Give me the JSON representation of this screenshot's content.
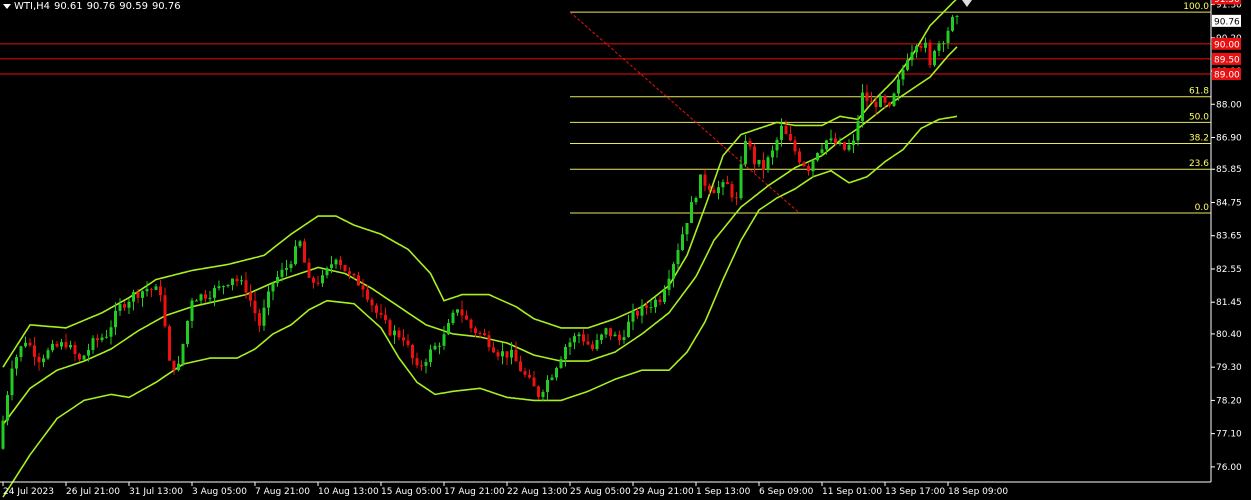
{
  "header": {
    "symbol": "WTI,H4",
    "open": "90.61",
    "high": "90.76",
    "low": "90.59",
    "close": "90.76"
  },
  "colors": {
    "background": "#000000",
    "bull": "#22cc22",
    "bear": "#ee1111",
    "bands": "#a8f020",
    "fib": "#e8e860",
    "sr_line": "#e81010",
    "grid_text": "#ffffff"
  },
  "chart_data": {
    "type": "candlestick",
    "symbol": "WTI",
    "timeframe": "H4",
    "ylim": [
      75.5,
      91.45
    ],
    "y_ticks": [
      76.0,
      77.1,
      78.2,
      79.3,
      80.4,
      81.45,
      82.55,
      83.65,
      84.75,
      85.85,
      86.9,
      88.0,
      89.1,
      90.2,
      91.3
    ],
    "x_ticks": [
      {
        "bar": 0,
        "label": "24 Jul 2023"
      },
      {
        "bar": 14,
        "label": "26 Jul 21:00"
      },
      {
        "bar": 28,
        "label": "31 Jul 13:00"
      },
      {
        "bar": 42,
        "label": "3 Aug 05:00"
      },
      {
        "bar": 56,
        "label": "7 Aug 21:00"
      },
      {
        "bar": 70,
        "label": "10 Aug 13:00"
      },
      {
        "bar": 84,
        "label": "15 Aug 05:00"
      },
      {
        "bar": 98,
        "label": "17 Aug 21:00"
      },
      {
        "bar": 112,
        "label": "22 Aug 13:00"
      },
      {
        "bar": 126,
        "label": "25 Aug 05:00"
      },
      {
        "bar": 140,
        "label": "29 Aug 21:00"
      },
      {
        "bar": 154,
        "label": "1 Sep 13:00"
      },
      {
        "bar": 168,
        "label": "6 Sep 09:00"
      },
      {
        "bar": 182,
        "label": "11 Sep 01:00"
      },
      {
        "bar": 196,
        "label": "13 Sep 17:00"
      },
      {
        "bar": 210,
        "label": "18 Sep 09:00"
      }
    ],
    "close_path": [
      [
        0,
        76.6
      ],
      [
        3,
        79.4
      ],
      [
        6,
        80.2
      ],
      [
        9,
        79.6
      ],
      [
        12,
        79.9
      ],
      [
        15,
        80.1
      ],
      [
        18,
        79.5
      ],
      [
        21,
        80.1
      ],
      [
        24,
        80.4
      ],
      [
        27,
        81.3
      ],
      [
        30,
        81.7
      ],
      [
        33,
        81.9
      ],
      [
        36,
        81.8
      ],
      [
        38,
        79.4
      ],
      [
        40,
        79.3
      ],
      [
        43,
        81.6
      ],
      [
        46,
        81.7
      ],
      [
        49,
        81.9
      ],
      [
        52,
        82.3
      ],
      [
        55,
        81.9
      ],
      [
        58,
        80.7
      ],
      [
        61,
        82.1
      ],
      [
        64,
        82.6
      ],
      [
        67,
        83.4
      ],
      [
        69,
        82.1
      ],
      [
        72,
        82.2
      ],
      [
        75,
        83.0
      ],
      [
        78,
        82.3
      ],
      [
        81,
        82.0
      ],
      [
        84,
        81.1
      ],
      [
        87,
        80.5
      ],
      [
        90,
        80.3
      ],
      [
        93,
        79.2
      ],
      [
        96,
        79.8
      ],
      [
        99,
        80.3
      ],
      [
        102,
        81.3
      ],
      [
        105,
        80.6
      ],
      [
        108,
        80.3
      ],
      [
        111,
        79.8
      ],
      [
        114,
        79.7
      ],
      [
        117,
        79.0
      ],
      [
        120,
        78.4
      ],
      [
        123,
        79.1
      ],
      [
        126,
        80.0
      ],
      [
        129,
        80.4
      ],
      [
        132,
        79.9
      ],
      [
        135,
        80.5
      ],
      [
        138,
        80.2
      ],
      [
        141,
        81.0
      ],
      [
        144,
        81.3
      ],
      [
        147,
        81.6
      ],
      [
        150,
        82.8
      ],
      [
        153,
        84.2
      ],
      [
        156,
        85.5
      ],
      [
        159,
        85.2
      ],
      [
        162,
        85.3
      ],
      [
        164,
        84.8
      ],
      [
        166,
        86.9
      ],
      [
        168,
        86.1
      ],
      [
        170,
        85.9
      ],
      [
        172,
        86.4
      ],
      [
        174,
        87.2
      ],
      [
        176,
        86.7
      ],
      [
        178,
        86.2
      ],
      [
        180,
        85.9
      ],
      [
        182,
        86.5
      ],
      [
        184,
        86.8
      ],
      [
        186,
        86.7
      ],
      [
        188,
        86.5
      ],
      [
        190,
        86.7
      ],
      [
        192,
        88.3
      ],
      [
        194,
        88.0
      ],
      [
        196,
        88.1
      ],
      [
        198,
        87.8
      ],
      [
        200,
        88.7
      ],
      [
        202,
        89.6
      ],
      [
        204,
        90.1
      ],
      [
        206,
        89.9
      ],
      [
        207,
        89.2
      ],
      [
        208,
        89.9
      ],
      [
        210,
        90.2
      ],
      [
        212,
        90.76
      ]
    ],
    "bands": {
      "upper": [
        [
          0,
          79.3
        ],
        [
          6,
          80.7
        ],
        [
          14,
          80.6
        ],
        [
          22,
          81.1
        ],
        [
          28,
          81.6
        ],
        [
          34,
          82.2
        ],
        [
          42,
          82.5
        ],
        [
          50,
          82.7
        ],
        [
          58,
          83.0
        ],
        [
          64,
          83.7
        ],
        [
          70,
          84.3
        ],
        [
          74,
          84.3
        ],
        [
          78,
          84.0
        ],
        [
          84,
          83.7
        ],
        [
          90,
          83.2
        ],
        [
          95,
          82.4
        ],
        [
          98,
          81.5
        ],
        [
          102,
          81.7
        ],
        [
          108,
          81.7
        ],
        [
          114,
          81.3
        ],
        [
          118,
          80.9
        ],
        [
          124,
          80.6
        ],
        [
          130,
          80.6
        ],
        [
          136,
          80.9
        ],
        [
          142,
          81.3
        ],
        [
          148,
          82.0
        ],
        [
          152,
          83.0
        ],
        [
          156,
          84.6
        ],
        [
          160,
          86.3
        ],
        [
          164,
          87.0
        ],
        [
          168,
          87.2
        ],
        [
          172,
          87.4
        ],
        [
          176,
          87.3
        ],
        [
          182,
          87.3
        ],
        [
          186,
          87.6
        ],
        [
          190,
          87.5
        ],
        [
          194,
          88.2
        ],
        [
          198,
          88.8
        ],
        [
          202,
          89.6
        ],
        [
          206,
          90.6
        ],
        [
          210,
          91.2
        ],
        [
          212,
          91.5
        ]
      ],
      "middle": [
        [
          0,
          77.4
        ],
        [
          6,
          78.6
        ],
        [
          12,
          79.2
        ],
        [
          18,
          79.5
        ],
        [
          24,
          79.9
        ],
        [
          30,
          80.5
        ],
        [
          36,
          81.0
        ],
        [
          42,
          81.3
        ],
        [
          48,
          81.5
        ],
        [
          54,
          81.7
        ],
        [
          60,
          82.1
        ],
        [
          66,
          82.4
        ],
        [
          70,
          82.6
        ],
        [
          76,
          82.4
        ],
        [
          82,
          81.9
        ],
        [
          88,
          81.3
        ],
        [
          94,
          80.7
        ],
        [
          100,
          80.4
        ],
        [
          106,
          80.3
        ],
        [
          112,
          80.1
        ],
        [
          118,
          79.7
        ],
        [
          124,
          79.5
        ],
        [
          130,
          79.5
        ],
        [
          136,
          79.8
        ],
        [
          142,
          80.4
        ],
        [
          148,
          81.1
        ],
        [
          154,
          82.3
        ],
        [
          158,
          83.5
        ],
        [
          164,
          84.6
        ],
        [
          170,
          85.3
        ],
        [
          176,
          85.9
        ],
        [
          182,
          86.3
        ],
        [
          186,
          86.8
        ],
        [
          190,
          87.2
        ],
        [
          196,
          87.9
        ],
        [
          202,
          88.5
        ],
        [
          206,
          88.9
        ],
        [
          210,
          89.6
        ],
        [
          212,
          89.9
        ]
      ],
      "lower": [
        [
          0,
          75.0
        ],
        [
          6,
          76.4
        ],
        [
          12,
          77.6
        ],
        [
          18,
          78.2
        ],
        [
          24,
          78.4
        ],
        [
          28,
          78.3
        ],
        [
          34,
          78.8
        ],
        [
          40,
          79.4
        ],
        [
          46,
          79.6
        ],
        [
          52,
          79.6
        ],
        [
          56,
          79.9
        ],
        [
          60,
          80.4
        ],
        [
          64,
          80.7
        ],
        [
          68,
          81.2
        ],
        [
          72,
          81.5
        ],
        [
          78,
          81.4
        ],
        [
          84,
          80.6
        ],
        [
          88,
          79.6
        ],
        [
          92,
          78.8
        ],
        [
          96,
          78.4
        ],
        [
          100,
          78.5
        ],
        [
          106,
          78.6
        ],
        [
          112,
          78.3
        ],
        [
          118,
          78.2
        ],
        [
          124,
          78.2
        ],
        [
          130,
          78.5
        ],
        [
          136,
          78.9
        ],
        [
          142,
          79.2
        ],
        [
          148,
          79.2
        ],
        [
          152,
          79.8
        ],
        [
          156,
          80.8
        ],
        [
          160,
          82.2
        ],
        [
          164,
          83.5
        ],
        [
          168,
          84.5
        ],
        [
          172,
          84.9
        ],
        [
          176,
          85.2
        ],
        [
          180,
          85.6
        ],
        [
          184,
          85.8
        ],
        [
          188,
          85.4
        ],
        [
          192,
          85.6
        ],
        [
          196,
          86.1
        ],
        [
          200,
          86.5
        ],
        [
          204,
          87.2
        ],
        [
          208,
          87.5
        ],
        [
          212,
          87.6
        ]
      ]
    },
    "horizontal_lines": [
      91.5,
      90.0,
      89.5,
      89.0
    ],
    "price_tags": [
      {
        "value": 91.5,
        "label": "91.50"
      },
      {
        "value": 90.0,
        "label": "90.00"
      },
      {
        "value": 89.5,
        "label": "89.50"
      },
      {
        "value": 89.0,
        "label": "89.00"
      }
    ],
    "current_price": {
      "value": 90.76,
      "label": "90.76"
    },
    "fibonacci": {
      "start_bar": 126,
      "levels": [
        {
          "level": "100.0",
          "price": 91.05
        },
        {
          "level": "61.8",
          "price": 88.25
        },
        {
          "level": "50.0",
          "price": 87.4
        },
        {
          "level": "38.2",
          "price": 86.7
        },
        {
          "level": "23.6",
          "price": 85.85
        },
        {
          "level": "0.0",
          "price": 84.4
        }
      ],
      "trend_line": {
        "from": [
          126,
          91.05
        ],
        "to": [
          177,
          84.4
        ]
      }
    }
  }
}
